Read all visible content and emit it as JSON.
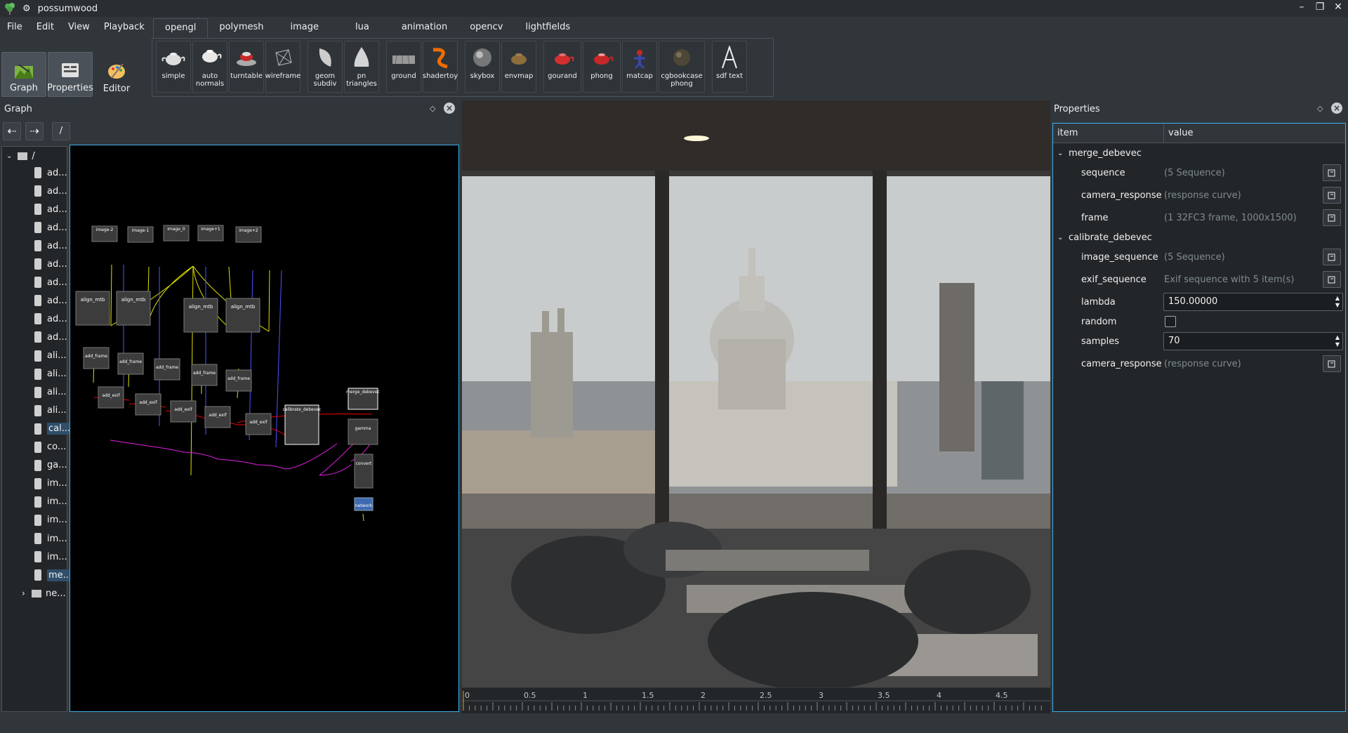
{
  "window": {
    "title": "possumwood",
    "minimize": "–",
    "maximize": "❐",
    "close": "✕"
  },
  "menu": [
    "File",
    "Edit",
    "View",
    "Playback"
  ],
  "big_buttons": [
    {
      "label": "Graph",
      "active": true
    },
    {
      "label": "Properties",
      "active": true
    },
    {
      "label": "Editor",
      "active": false
    }
  ],
  "tabs": [
    "opengl",
    "polymesh",
    "image",
    "lua",
    "animation",
    "opencv",
    "lightfields"
  ],
  "shelf": [
    {
      "label": "simple",
      "icon": "teapot-icon"
    },
    {
      "label": "auto normals",
      "icon": "teapot-icon"
    },
    {
      "label": "turntable",
      "icon": "turntable-icon"
    },
    {
      "label": "wireframe",
      "icon": "wireframe-icon"
    },
    {
      "label": "geom subdiv",
      "icon": "subdiv-icon"
    },
    {
      "label": "pn triangles",
      "icon": "pn-icon"
    },
    {
      "label": "ground",
      "icon": "ground-icon"
    },
    {
      "label": "shadertoy",
      "icon": "shadertoy-icon"
    },
    {
      "label": "skybox",
      "icon": "skybox-icon"
    },
    {
      "label": "envmap",
      "icon": "envmap-icon"
    },
    {
      "label": "gourand",
      "icon": "red-teapot-icon"
    },
    {
      "label": "phong",
      "icon": "red-teapot-icon"
    },
    {
      "label": "matcap",
      "icon": "matcap-icon"
    },
    {
      "label": "cgbookcase phong",
      "icon": "sphere-icon"
    },
    {
      "label": "sdf text",
      "icon": "sdf-text-icon"
    }
  ],
  "graph_panel": {
    "title": "Graph",
    "back": "⇠",
    "forward": "⇢",
    "path": "/"
  },
  "tree": {
    "root": "/",
    "items": [
      "ad...",
      "ad...",
      "ad...",
      "ad...",
      "ad...",
      "ad...",
      "ad...",
      "ad...",
      "ad...",
      "ad...",
      "ali...",
      "ali...",
      "ali...",
      "ali...",
      "cal...",
      "co...",
      "ga...",
      "im...",
      "im...",
      "im...",
      "im...",
      "im...",
      "me...",
      "ne..."
    ],
    "selected": [
      14,
      22
    ]
  },
  "graph_nodes": {
    "image_m2": "image-2",
    "image_m1": "image-1",
    "image_0": "image_0",
    "image_p1": "image+1",
    "image_p2": "image+2",
    "align": "align_mtb",
    "add_frame": "add_frame",
    "add_exif": "add_exif",
    "calibrate": "calibrate_debevec",
    "merge": "merge_debevec",
    "gamma": "gamma",
    "convert": "convert",
    "network": "network"
  },
  "properties_panel": {
    "title": "Properties",
    "col_item": "item",
    "col_value": "value",
    "groups": [
      {
        "name": "merge_debevec",
        "rows": [
          {
            "name": "sequence",
            "value": "(5 Sequence)"
          },
          {
            "name": "camera_response",
            "value": "(response curve)"
          },
          {
            "name": "frame",
            "value": "(1 32FC3 frame, 1000x1500)"
          }
        ]
      },
      {
        "name": "calibrate_debevec",
        "rows": [
          {
            "name": "image_sequence",
            "value": "(5 Sequence)"
          },
          {
            "name": "exif_sequence",
            "value": "Exif sequence with 5 item(s)"
          },
          {
            "name": "lambda",
            "value": "150.00000"
          },
          {
            "name": "random",
            "value": ""
          },
          {
            "name": "samples",
            "value": "70"
          },
          {
            "name": "camera_response",
            "value": "(response curve)"
          }
        ]
      }
    ]
  },
  "timeline": {
    "ticks": [
      "0",
      "0.5",
      "1",
      "1.5",
      "2",
      "2.5",
      "3",
      "3.5",
      "4",
      "4.5"
    ]
  },
  "colors": {
    "accent": "#3daee9",
    "bg": "#31363b",
    "panel": "#232629"
  }
}
